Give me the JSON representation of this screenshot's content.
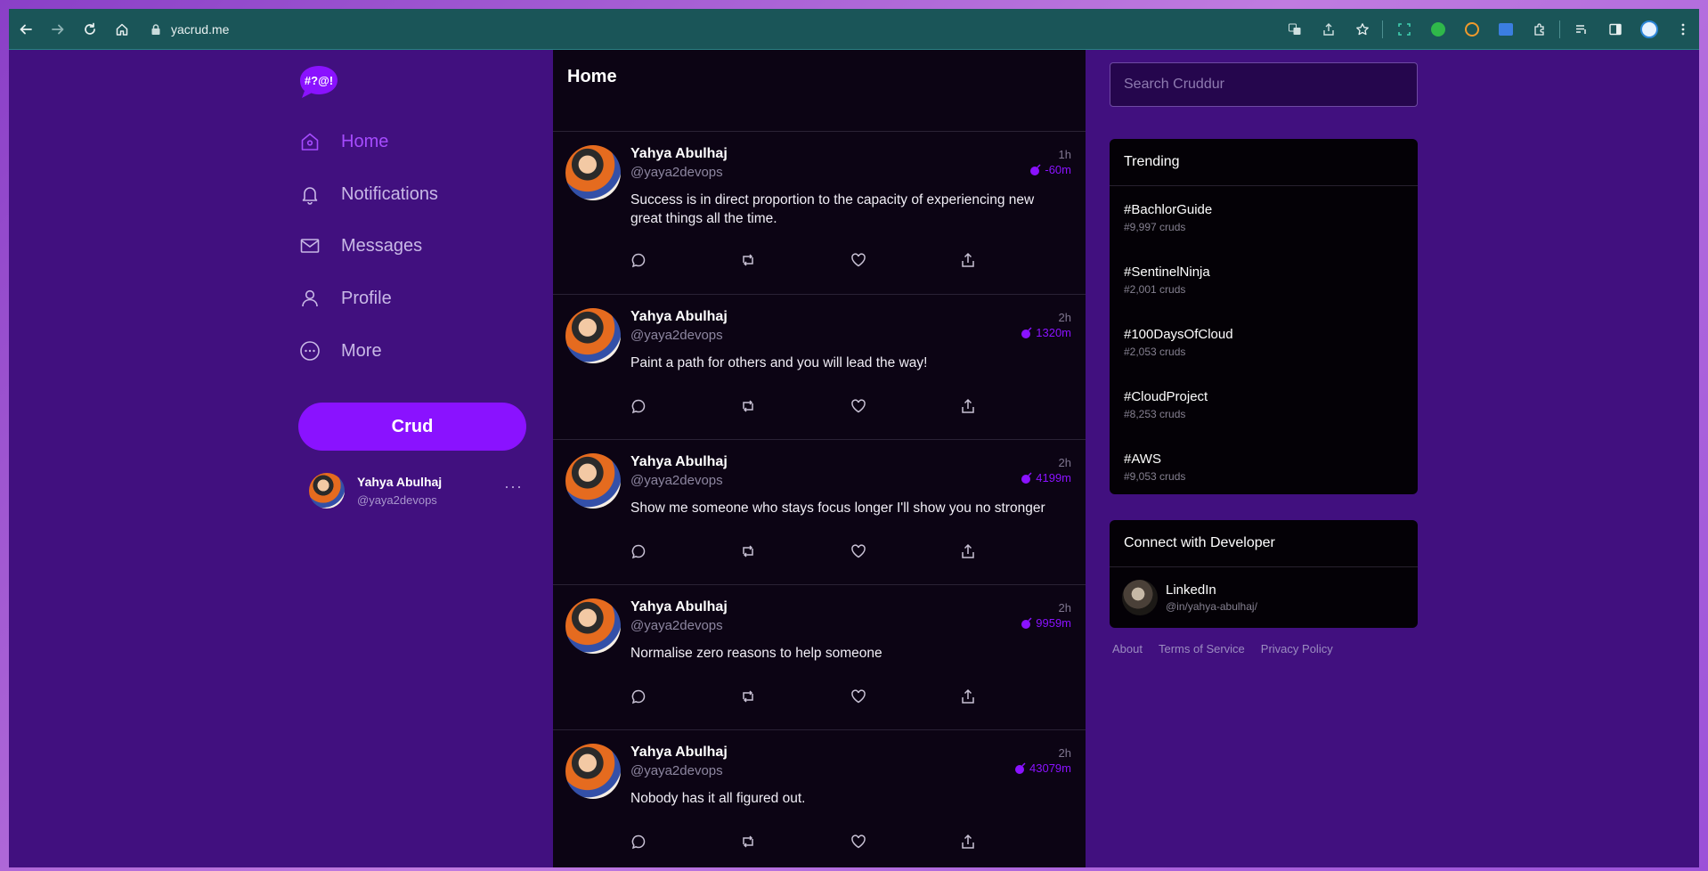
{
  "browser": {
    "url": "yacrud.me"
  },
  "nav": {
    "logo_text": "#?@!",
    "items": [
      {
        "label": "Home",
        "icon": "home-icon",
        "active": true
      },
      {
        "label": "Notifications",
        "icon": "bell-icon",
        "active": false
      },
      {
        "label": "Messages",
        "icon": "mail-icon",
        "active": false
      },
      {
        "label": "Profile",
        "icon": "user-icon",
        "active": false
      },
      {
        "label": "More",
        "icon": "more-icon",
        "active": false
      }
    ],
    "crud_label": "Crud",
    "me": {
      "name": "Yahya Abulhaj",
      "handle": "@yaya2devops",
      "menu": "···"
    }
  },
  "feed": {
    "title": "Home",
    "posts": [
      {
        "name": "Yahya Abulhaj",
        "handle": "@yaya2devops",
        "time": "1h",
        "expires": "-60m",
        "text": "Success is in direct proportion to the capacity of experiencing new great things all the time."
      },
      {
        "name": "Yahya Abulhaj",
        "handle": "@yaya2devops",
        "time": "2h",
        "expires": "1320m",
        "text": "Paint a path for others and you will lead the way!"
      },
      {
        "name": "Yahya Abulhaj",
        "handle": "@yaya2devops",
        "time": "2h",
        "expires": "4199m",
        "text": "Show me someone who stays focus longer I'll show you no stronger"
      },
      {
        "name": "Yahya Abulhaj",
        "handle": "@yaya2devops",
        "time": "2h",
        "expires": "9959m",
        "text": "Normalise zero reasons to help someone"
      },
      {
        "name": "Yahya Abulhaj",
        "handle": "@yaya2devops",
        "time": "2h",
        "expires": "43079m",
        "text": "Nobody has it all figured out."
      }
    ]
  },
  "search": {
    "placeholder": "Search Cruddur"
  },
  "trending": {
    "title": "Trending",
    "items": [
      {
        "tag": "#BachlorGuide",
        "count": "#9,997 cruds"
      },
      {
        "tag": "#SentinelNinja",
        "count": "#2,001 cruds"
      },
      {
        "tag": "#100DaysOfCloud",
        "count": "#2,053 cruds"
      },
      {
        "tag": "#CloudProject",
        "count": "#8,253 cruds"
      },
      {
        "tag": "#AWS",
        "count": "#9,053 cruds"
      }
    ]
  },
  "connect": {
    "title": "Connect with Developer",
    "name": "LinkedIn",
    "handle": "@in/yahya-abulhaj/"
  },
  "footer": {
    "about": "About",
    "terms": "Terms of Service",
    "privacy": "Privacy Policy"
  },
  "colors": {
    "accent": "#8a12ff",
    "page_bg": "#41107f",
    "feed_bg": "#0c0414",
    "browser_bar": "#1a5558"
  }
}
